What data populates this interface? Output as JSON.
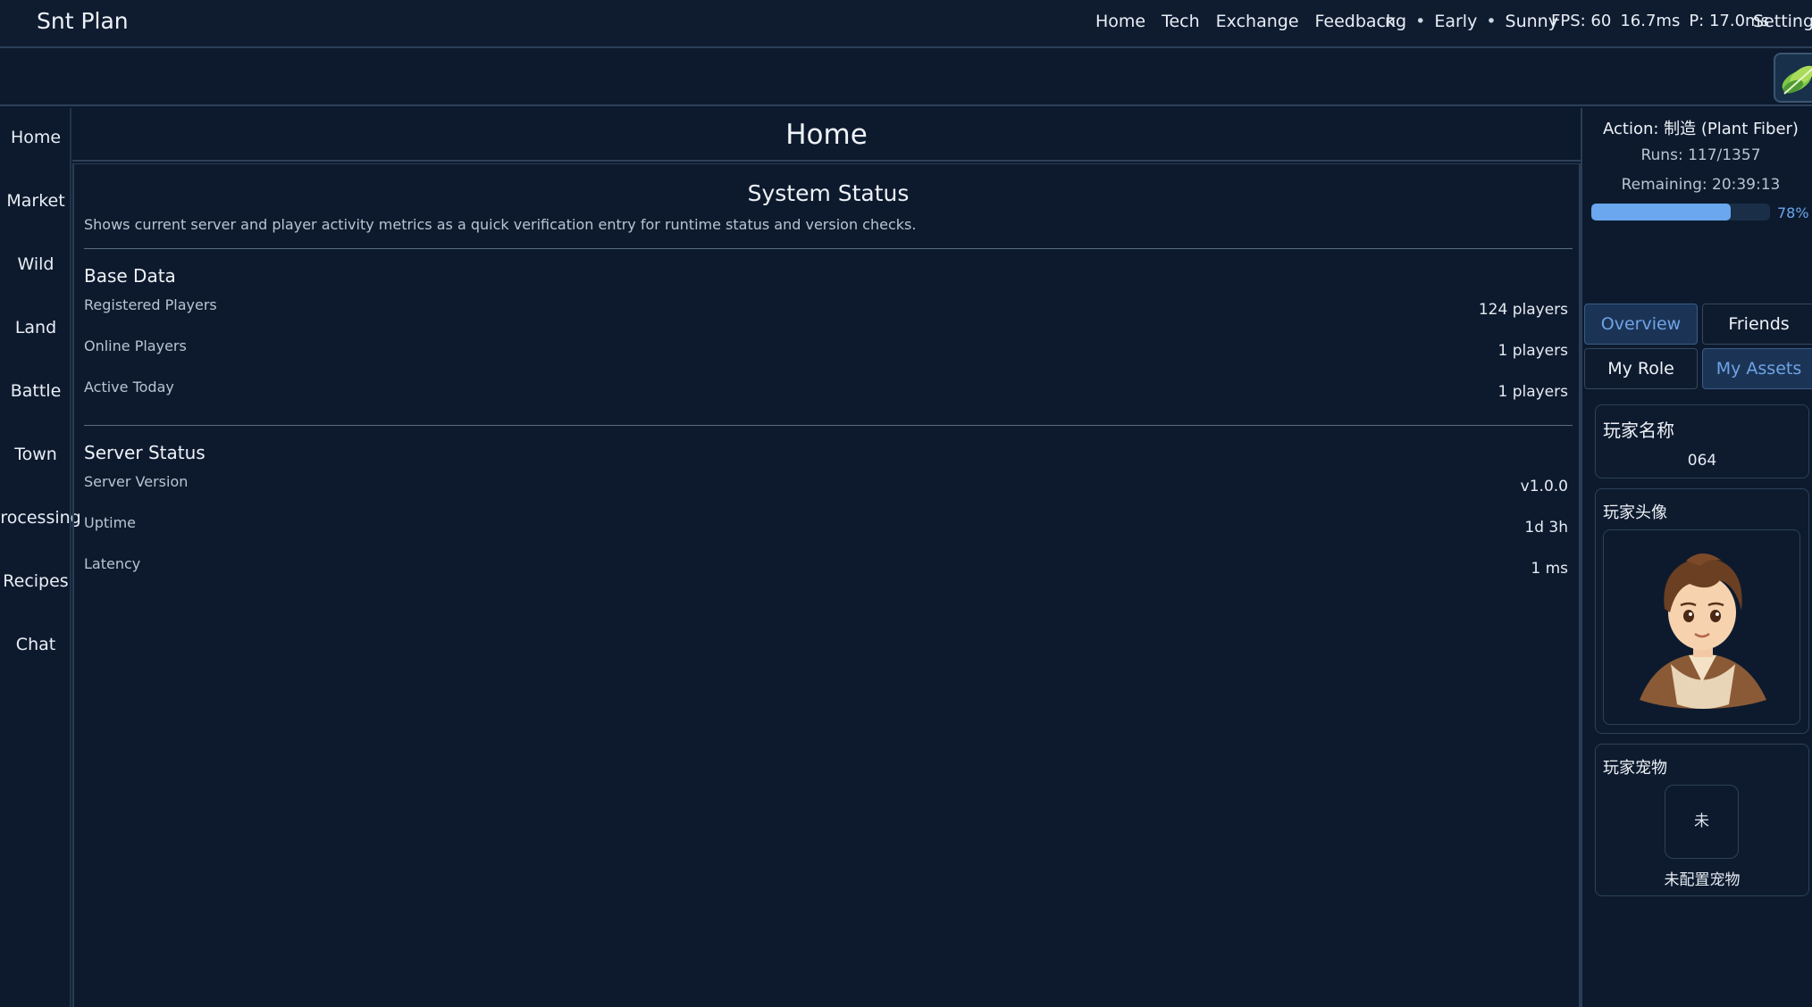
{
  "app": {
    "title": "Snt Plan"
  },
  "topnav": {
    "items": [
      "Home",
      "Tech",
      "Exchange",
      "Feedback"
    ]
  },
  "status": {
    "time_fragment": "ng",
    "phase": "Early",
    "weather": "Sunny",
    "separator": "•"
  },
  "perf": {
    "fps": "FPS: 60",
    "frame_ms": "16.7ms",
    "p_ms": "P: 17.0ms"
  },
  "settings": {
    "label": "Settings"
  },
  "sidenav": {
    "items": [
      "Home",
      "Market",
      "Wild",
      "Land",
      "Battle",
      "Town",
      "Processing",
      "Recipes",
      "Chat"
    ]
  },
  "main": {
    "page_title": "Home",
    "panel": {
      "title": "System Status",
      "description": "Shows current server and player activity metrics as a quick verification entry for runtime status and version checks.",
      "base_data": {
        "title": "Base Data",
        "rows": [
          {
            "label": "Registered Players",
            "value": "124 players"
          },
          {
            "label": "Online Players",
            "value": "1 players"
          },
          {
            "label": "Active Today",
            "value": "1 players"
          }
        ]
      },
      "server_status": {
        "title": "Server Status",
        "rows": [
          {
            "label": "Server Version",
            "value": "v1.0.0"
          },
          {
            "label": "Uptime",
            "value": "1d 3h"
          },
          {
            "label": "Latency",
            "value": "1 ms"
          }
        ]
      }
    }
  },
  "right": {
    "action": "Action: 制造 (Plant Fiber)",
    "runs": "Runs: 117/1357",
    "remaining": "Remaining: 20:39:13",
    "progress": {
      "percent_label": "78%",
      "value": 78
    },
    "tabs": [
      {
        "label": "Overview",
        "active": true
      },
      {
        "label": "Friends",
        "active": false
      },
      {
        "label": "My Role",
        "active": false
      },
      {
        "label": "My Assets",
        "active": true
      }
    ],
    "name_card": {
      "title": "玩家名称",
      "value": "064"
    },
    "avatar_card": {
      "title": "玩家头像"
    },
    "pet_card": {
      "title": "玩家宠物",
      "placeholder_glyph": "未",
      "status": "未配置宠物"
    }
  },
  "colors": {
    "background": "#0d1a2e",
    "accent": "#6aa7ee",
    "active_tab_bg": "#1b3456",
    "border": "#2c4058"
  }
}
